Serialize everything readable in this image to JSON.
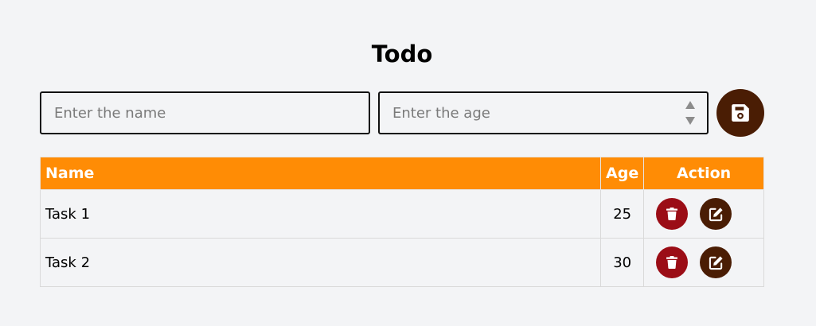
{
  "header": {
    "title": "Todo"
  },
  "form": {
    "name_placeholder": "Enter the name",
    "age_placeholder": "Enter the age",
    "save_icon": "save-icon"
  },
  "table": {
    "columns": [
      "Name",
      "Age",
      "Action"
    ],
    "rows": [
      {
        "name": "Task 1",
        "age": "25"
      },
      {
        "name": "Task 2",
        "age": "30"
      }
    ]
  },
  "colors": {
    "background": "#f3f4f6",
    "header_bg": "#ff8c05",
    "save_button": "#4a1d04",
    "delete_button": "#9b0d16",
    "edit_button": "#4a1d04"
  }
}
